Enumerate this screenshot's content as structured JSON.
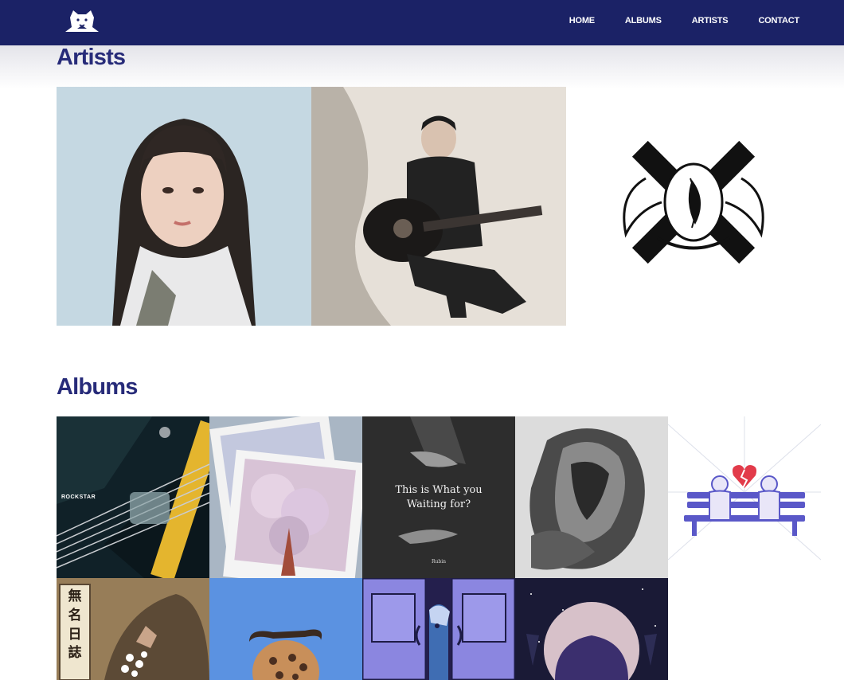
{
  "nav": {
    "links": [
      "HOME",
      "ALBUMS",
      "ARTISTS",
      "CONTACT"
    ],
    "background": "#1b2266",
    "logo_icon": "bear-head-logo-icon"
  },
  "artists": {
    "heading": "Artists",
    "items": [
      {
        "image": "female-portrait-photo"
      },
      {
        "image": "man-with-acoustic-guitar-photo"
      },
      {
        "image": "crossed-feathers-emblem-logo"
      }
    ]
  },
  "albums": {
    "heading": "Albums",
    "items": [
      {
        "image": "guitar-closeup-cover",
        "text": "ROCKSTAR"
      },
      {
        "image": "cherry-blossom-polaroids-cover"
      },
      {
        "image": "reaching-hands-cover",
        "text": "This is What you Waiting for?",
        "credit": "Rubin"
      },
      {
        "image": "engraved-bird-illustration-cover"
      },
      {
        "image": "broken-heart-bench-cover"
      },
      {
        "image": "flowers-diary-cover",
        "text": "無名日誌"
      },
      {
        "image": "cookie-blue-background-cover"
      },
      {
        "image": "door-peeking-character-cover"
      },
      {
        "image": "moon-night-sky-cover"
      }
    ]
  },
  "colors": {
    "heading": "#272b79",
    "fade": "#e4e4ea"
  }
}
